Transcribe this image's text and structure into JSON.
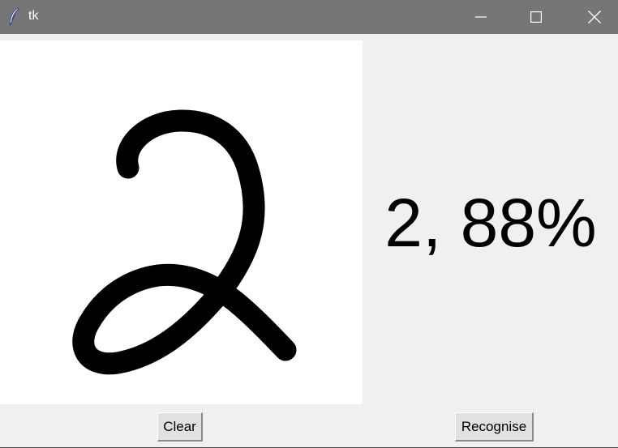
{
  "window": {
    "title": "tk",
    "icon": "feather-icon",
    "controls": [
      "minimize-icon",
      "maximize-icon",
      "close-icon"
    ]
  },
  "canvas": {
    "background": "#ffffff",
    "stroke_color": "#000000",
    "drawn_content": "handwritten digit"
  },
  "result": {
    "text": "2, 88%"
  },
  "buttons": {
    "clear_label": "Clear",
    "recognise_label": "Recognise"
  },
  "colors": {
    "titlebar": "#767676",
    "window_bg": "#f0f0f0",
    "button_bg": "#e1e1e1"
  }
}
